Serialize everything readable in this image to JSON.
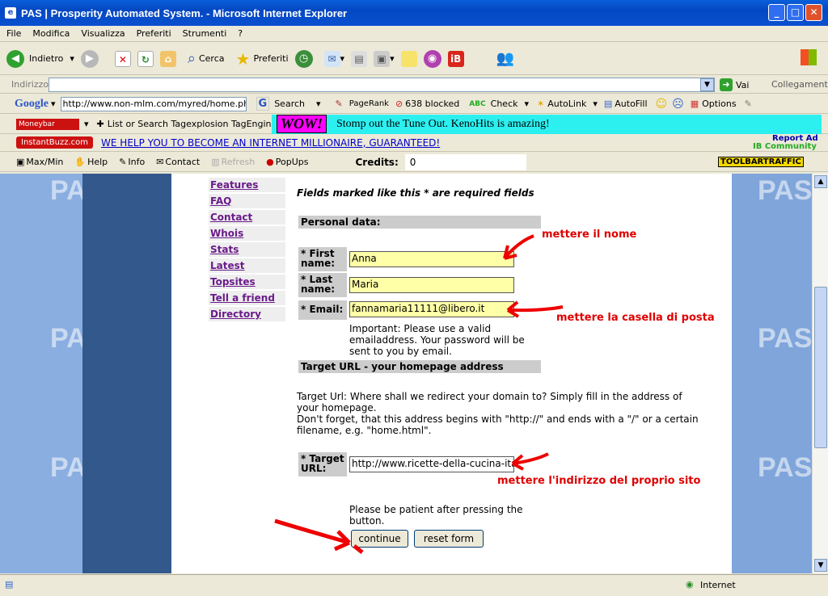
{
  "window": {
    "title": "PAS | Prosperity Automated System. - Microsoft Internet Explorer",
    "icon": "ie-icon"
  },
  "menu": [
    "File",
    "Modifica",
    "Visualizza",
    "Preferiti",
    "Strumenti",
    "?"
  ],
  "toolbar": {
    "back": "Indietro",
    "search": "Cerca",
    "favorites": "Preferiti"
  },
  "address": {
    "label": "Indirizzo",
    "go": "Vai",
    "links": "Collegamenti"
  },
  "google": {
    "logo": "Google",
    "url": "http://www.non-mlm.com/myred/home.php",
    "search": "Search",
    "pagerank": "PageRank",
    "blocked": "638 blocked",
    "check": "Check",
    "autolink": "AutoLink",
    "autofill": "AutoFill",
    "options": "Options"
  },
  "wow": {
    "moneybar": "Moneybar",
    "tagexplosion": "List or Search Tagexplosion TagEngine",
    "wow": "WOW!",
    "banner": "Stomp out the Tune Out. KenoHits is amazing!"
  },
  "ib": {
    "logo": "InstantBuzz.com",
    "link": "WE HELP YOU TO BECOME AN INTERNET MILLIONAIRE, GUARANTEED!",
    "report": "Report Ad",
    "community": "IB Community"
  },
  "pasbar": {
    "maxmin": "Max/Min",
    "help": "Help",
    "info": "Info",
    "contact": "Contact",
    "refresh": "Refresh",
    "popups": "PopUps",
    "credits_label": "Credits:",
    "credits": "0",
    "logo": "TOOLBARTRAFFIC"
  },
  "nav": [
    "Features",
    "FAQ",
    "Contact",
    "Whois",
    "Stats",
    "Latest",
    "Topsites",
    "Tell a friend",
    "Directory"
  ],
  "form": {
    "required_note": "Fields marked like this * are required fields",
    "personal_header": "Personal data:",
    "first_label": "* First name:",
    "first_value": "Anna",
    "last_label": "* Last name:",
    "last_value": "Maria",
    "email_label": "* Email:",
    "email_value": "fannamaria11111@libero.it",
    "important": "Important: Please use a valid emailaddress. Your password will be sent to you by email.",
    "target_header": "Target URL - your homepage address",
    "target_desc1": "Target Url: Where shall we redirect your domain to? Simply fill in the address of your homepage.",
    "target_desc2": "Don't forget, that this address begins with \"http://\" and ends with a \"/\" or a certain filename, e.g. \"home.html\".",
    "target_label": "* Target URL:",
    "target_value": "http://www.ricette-della-cucina-itali",
    "patient": "Please be patient after pressing the button.",
    "continue": "continue",
    "reset": "reset form"
  },
  "annotations": {
    "name": "mettere il nome",
    "email": "mettere la casella di posta",
    "url": "mettere l'indirizzo del proprio sito"
  },
  "status": {
    "zone": "Internet"
  }
}
